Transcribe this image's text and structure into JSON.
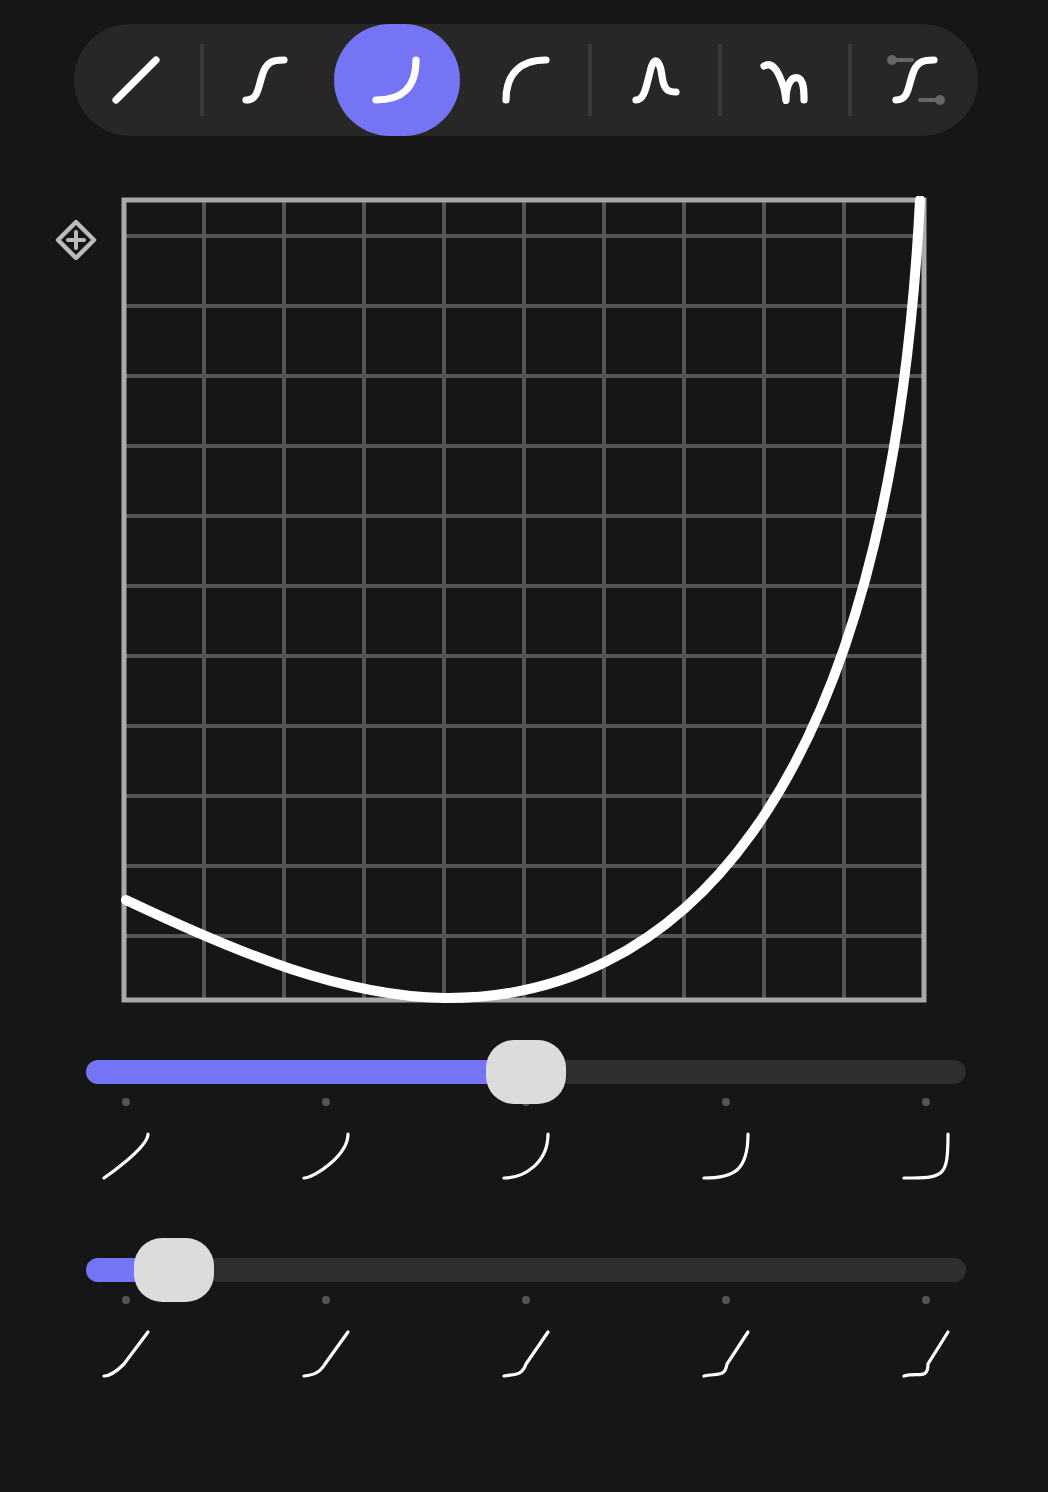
{
  "toolbar": {
    "tools": [
      {
        "kind": "linear",
        "selected": false
      },
      {
        "kind": "s-curve",
        "selected": false
      },
      {
        "kind": "ease-in",
        "selected": true
      },
      {
        "kind": "ease-out",
        "selected": false
      },
      {
        "kind": "bump",
        "selected": false
      },
      {
        "kind": "wave",
        "selected": false
      },
      {
        "kind": "custom",
        "selected": false
      }
    ]
  },
  "sliders": [
    {
      "kind": "curvature",
      "level": 0.5
    },
    {
      "kind": "dip",
      "level": 0.1
    }
  ]
}
